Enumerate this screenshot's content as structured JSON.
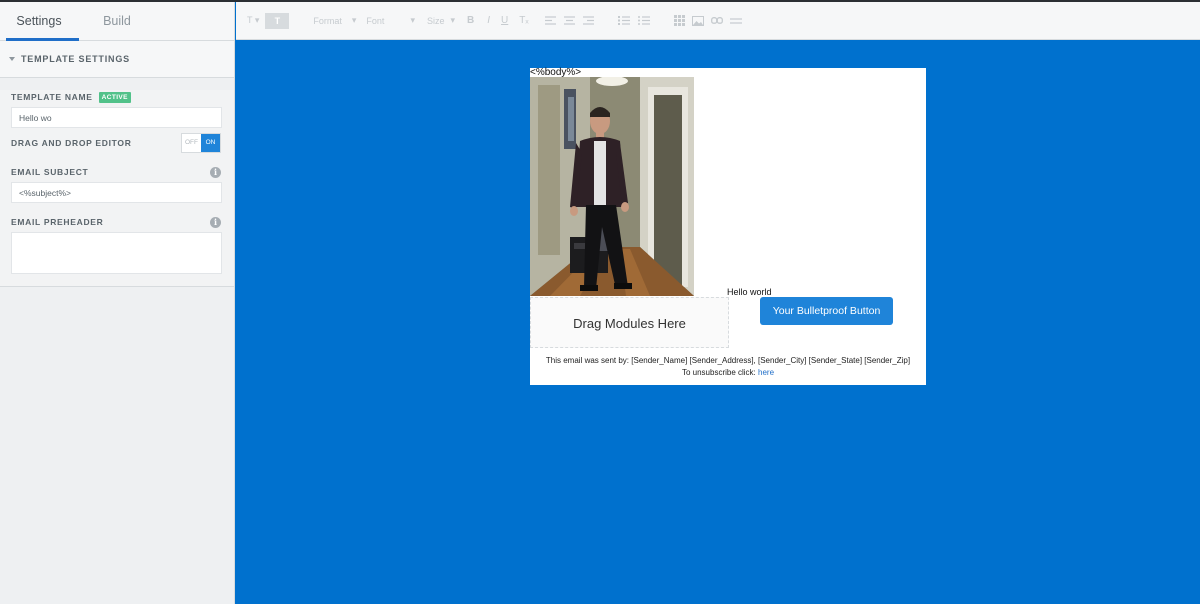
{
  "sidebar": {
    "tabs": [
      {
        "label": "Settings",
        "active": true
      },
      {
        "label": "Build",
        "active": false
      }
    ],
    "section_title": "TEMPLATE SETTINGS",
    "template_name": {
      "label": "TEMPLATE NAME",
      "badge": "ACTIVE",
      "value": "Hello wo"
    },
    "drag_drop": {
      "label": "DRAG AND DROP EDITOR",
      "off": "OFF",
      "on": "ON",
      "state": "on"
    },
    "email_subject": {
      "label": "EMAIL SUBJECT",
      "value": "<%subject%>"
    },
    "email_preheader": {
      "label": "EMAIL PREHEADER",
      "value": ""
    }
  },
  "toolbar": {
    "text_style": "T",
    "text_color": "T",
    "format": "Format",
    "font": "Font",
    "size": "Size",
    "bold": "B",
    "italic": "I",
    "underline": "U",
    "clear_format": "Tₓ"
  },
  "email": {
    "body_tag": "<%body%>",
    "hello_text": "Hello world",
    "dropzone_text": "Drag Modules Here",
    "button_text": "Your Bulletproof Button",
    "footer_line1": "This email was sent by: [Sender_Name] [Sender_Address], [Sender_City] [Sender_State] [Sender_Zip]",
    "footer_line2_prefix": "To unsubscribe click: ",
    "footer_link": "here"
  },
  "colors": {
    "canvas_bg": "#0071ce",
    "accent": "#1f84d9",
    "active_badge": "#52c28a"
  }
}
